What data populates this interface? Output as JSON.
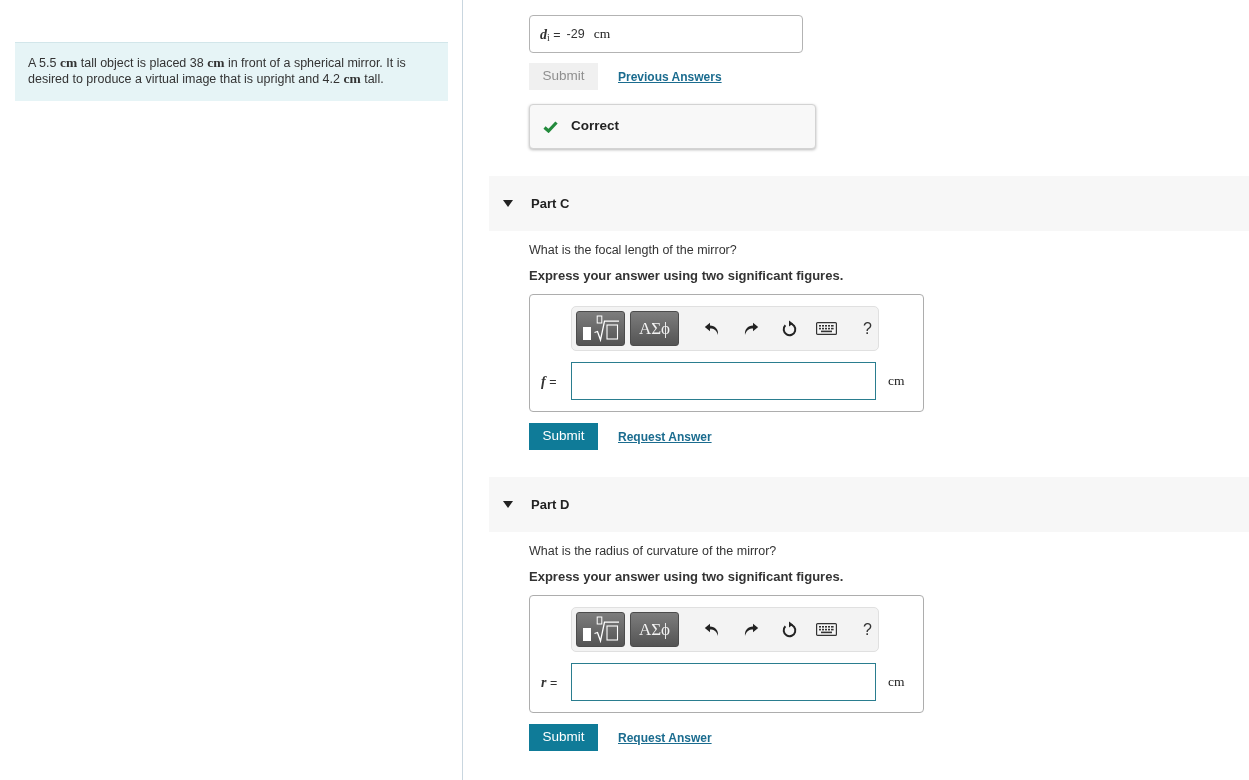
{
  "problem": {
    "text": "A 5.5 **cm** tall object is placed 38 **cm** in front of a spherical mirror. It is desired to produce a virtual image that is upright and 4.2 **cm** tall."
  },
  "previous_part": {
    "answer": {
      "variable": "*d*$_{i}$ =",
      "value": "-29",
      "unit": "cm"
    },
    "submit": {
      "label": "Submit",
      "disabled": true
    },
    "link": "Previous Answers",
    "feedback": {
      "kind": "correct",
      "text": "Correct"
    }
  },
  "parts": [
    {
      "title": "Part C",
      "expanded": true,
      "question": "What is the focal length of the mirror?",
      "instruction": "Express your answer using two significant figures.",
      "toolbar": {
        "symbols": "ΑΣϕ",
        "help": "?"
      },
      "answer": {
        "variable": "*f* =",
        "unit": "cm"
      },
      "submit": {
        "label": "Submit",
        "disabled": false
      },
      "link": "Request Answer"
    },
    {
      "title": "Part D",
      "expanded": true,
      "question": "What is the radius of curvature of the mirror?",
      "instruction": "Express your answer using two significant figures.",
      "toolbar": {
        "symbols": "ΑΣϕ",
        "help": "?"
      },
      "answer": {
        "variable": "*r* =",
        "unit": "cm"
      },
      "submit": {
        "label": "Submit",
        "disabled": false
      },
      "link": "Request Answer"
    }
  ]
}
